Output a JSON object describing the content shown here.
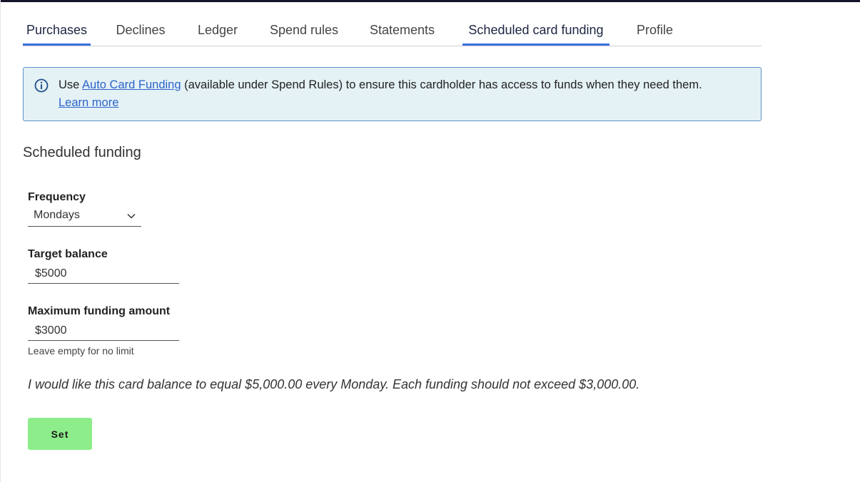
{
  "tabs": [
    {
      "label": "Purchases",
      "active": true
    },
    {
      "label": "Declines",
      "active": false
    },
    {
      "label": "Ledger",
      "active": false
    },
    {
      "label": "Spend rules",
      "active": false
    },
    {
      "label": "Statements",
      "active": false
    },
    {
      "label": "Scheduled card funding",
      "active": true
    },
    {
      "label": "Profile",
      "active": false
    }
  ],
  "banner": {
    "icon": "info-icon",
    "prefix": "Use ",
    "link_text": "Auto Card Funding",
    "suffix": " (available under Spend Rules) to ensure this cardholder has access to funds when they need them.",
    "learn_more": "Learn more"
  },
  "section_title": "Scheduled funding",
  "form": {
    "frequency_label": "Frequency",
    "frequency_value": "Mondays",
    "target_label": "Target balance",
    "target_value": "$5000",
    "max_label": "Maximum funding amount",
    "max_value": "$3000",
    "max_helper": "Leave empty for no limit"
  },
  "summary": "I would like this card balance to equal $5,000.00 every Monday. Each funding should not exceed $3,000.00.",
  "set_button": "Set",
  "colors": {
    "accent": "#3c71e0",
    "banner_bg": "#e4f1f5",
    "banner_border": "#5b93c7",
    "button_bg": "#8ded8a"
  }
}
